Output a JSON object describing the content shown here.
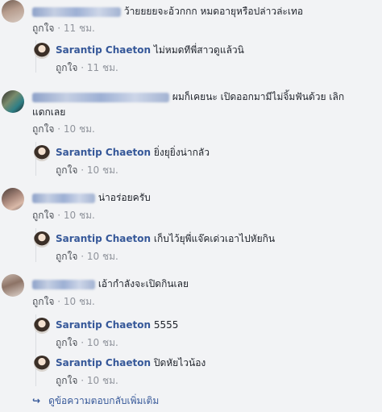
{
  "comments": [
    {
      "text": "ว้ายยยยจะอ้วกกก หมดอายุหรือปล่าวล่ะเทอ",
      "like": "ถูกใจ",
      "time": "11 ชม.",
      "reply": {
        "name": "Sarantip Chaeton",
        "text": "ไม่หมดทีพี่สาวดูแล้วนิ",
        "like": "ถูกใจ",
        "time": "11 ชม."
      }
    },
    {
      "text_line1": "ผมก็เคยนะ เปิดออกมามีไม่จิ้มฟันด้วย เลิก",
      "text_line2": "แดกเลย",
      "like": "ถูกใจ",
      "time": "10 ชม.",
      "reply": {
        "name": "Sarantip Chaeton",
        "text": "ยิ่งยุยิ่งน่ากลัว",
        "like": "ถูกใจ",
        "time": "10 ชม."
      }
    },
    {
      "text": "น่าอร่อยครับ",
      "like": "ถูกใจ",
      "time": "10 ชม.",
      "reply": {
        "name": "Sarantip Chaeton",
        "text": "เก็บไว้ยุพี่แจ๊คเด่วเอาไปหัยกิน",
        "like": "ถูกใจ",
        "time": "10 ชม."
      }
    },
    {
      "text": "เอ้ากำลังจะเปิดกินเลย",
      "like": "ถูกใจ",
      "time": "10 ชม.",
      "replies": [
        {
          "name": "Sarantip Chaeton",
          "text": "5555",
          "like": "ถูกใจ",
          "time": "10 ชม."
        },
        {
          "name": "Sarantip Chaeton",
          "text": "ปิดหัยไวน้อง",
          "like": "ถูกใจ",
          "time": "10 ชม."
        }
      ]
    }
  ],
  "more_replies_label": "ดูข้อความตอบกลับเพิ่มเติม",
  "dot": "·"
}
